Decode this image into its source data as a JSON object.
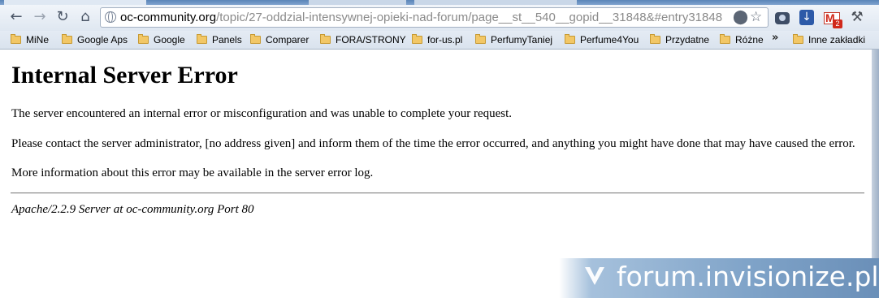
{
  "browser": {
    "url_host": "oc-community.org",
    "url_path": "/topic/27-oddzial-intensywnej-opieki-nad-forum/page__st__540__gopid__31848&#entry31848",
    "nav_icons": [
      "back-icon",
      "forward-icon",
      "reload-icon",
      "home-icon"
    ],
    "extension_icons": [
      "camera-icon",
      "download-icon",
      "gmail-icon",
      "wrench-icon"
    ],
    "gmail_badge": "2",
    "bookmarks": [
      {
        "label": "MiNe"
      },
      {
        "label": "Google Aps"
      },
      {
        "label": "Google"
      },
      {
        "label": "Panels"
      },
      {
        "label": "Comparer"
      },
      {
        "label": "FORA/STRONY"
      },
      {
        "label": "for-us.pl"
      },
      {
        "label": "PerfumyTaniej"
      },
      {
        "label": "Perfume4You"
      },
      {
        "label": "Przydatne"
      },
      {
        "label": "Różne"
      }
    ],
    "overflow_chevron": "»",
    "other_bookmarks": "Inne zakładki"
  },
  "page": {
    "heading": "Internal Server Error",
    "paragraph1": "The server encountered an internal error or misconfiguration and was unable to complete your request.",
    "paragraph2": "Please contact the server administrator, [no address given] and inform them of the time the error occurred, and anything you might have done that may have caused the error.",
    "paragraph3": "More information about this error may be available in the server error log.",
    "signature": "Apache/2.2.9 Server at oc-community.org Port 80"
  },
  "watermark": {
    "text": "forum.invisionize.pl"
  }
}
